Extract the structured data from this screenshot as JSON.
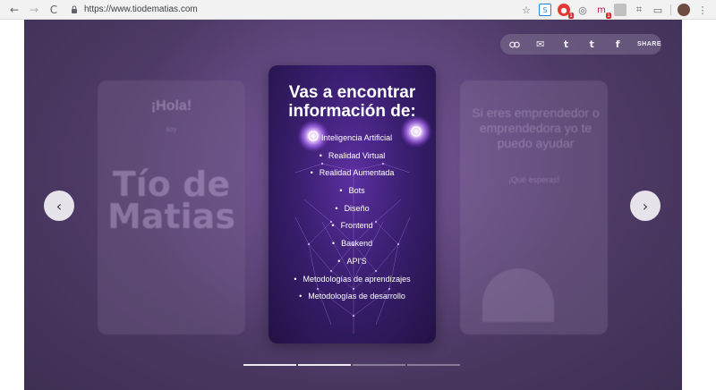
{
  "browser": {
    "url": "https://www.tiodematias.com",
    "back_icon": "←",
    "forward_icon": "→",
    "reload_icon": "C",
    "lock_icon": "🔒",
    "extensions": [
      {
        "name": "star-icon",
        "glyph": "☆"
      },
      {
        "name": "extension-blue-icon",
        "glyph": "S"
      },
      {
        "name": "extension-red-icon",
        "glyph": "●",
        "badge": "1"
      },
      {
        "name": "extension-target-icon",
        "glyph": "◎"
      },
      {
        "name": "extension-mp-icon",
        "glyph": "m",
        "badge": "1"
      },
      {
        "name": "extension-gray-icon",
        "glyph": ""
      },
      {
        "name": "extension-crop-icon",
        "glyph": "⌗"
      },
      {
        "name": "extension-cast-icon",
        "glyph": "▭"
      }
    ],
    "menu_icon": "⋮"
  },
  "share": {
    "link_icon": "🔗",
    "mail_icon": "✉",
    "twitter_icon": "t",
    "tumblr_icon": "t",
    "facebook_icon": "f",
    "label": "SHARE"
  },
  "side_left": {
    "greeting": "¡Hola!",
    "small": "soy",
    "brand": "Tío de Matias"
  },
  "side_right": {
    "text": "Si eres emprendedor o emprendedora yo te puedo ayudar",
    "small": "¡Qué esperas!"
  },
  "card": {
    "title": "Vas a encontrar información de:",
    "items": [
      "Inteligencia Artificial",
      "Realidad Virtual",
      "Realidad Aumentada",
      "Bots",
      "Diseño",
      "Frontend",
      "Backend",
      "API'S",
      "Metodologías de aprendizajes",
      "Metodologías de desarrollo"
    ]
  },
  "nav": {
    "prev_icon": "‹",
    "next_icon": "›"
  },
  "progress": {
    "total": 4,
    "active": 2
  }
}
